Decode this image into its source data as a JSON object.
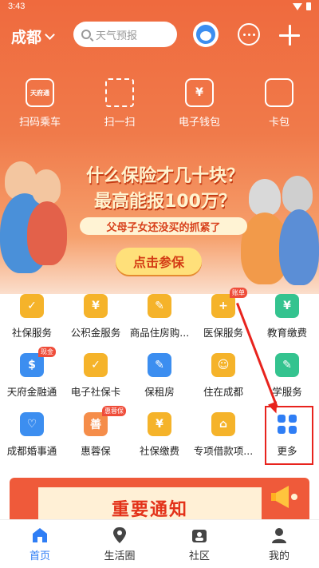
{
  "status_bar": {
    "time": "3:43"
  },
  "header": {
    "city": "成都",
    "search_placeholder": "天气预报"
  },
  "quick_actions": [
    {
      "label": "扫码乘车",
      "icon": "bus-card-icon",
      "glyph": "天府通"
    },
    {
      "label": "扫一扫",
      "icon": "scan-icon",
      "glyph": ""
    },
    {
      "label": "电子钱包",
      "icon": "wallet-icon",
      "glyph": "¥"
    },
    {
      "label": "卡包",
      "icon": "card-wallet-icon",
      "glyph": ""
    }
  ],
  "banner": {
    "title_line1": "什么保险才几十块？",
    "title_line2": "最高能报100万？",
    "subtitle": "父母子女还没买的抓紧了",
    "cta": "点击参保"
  },
  "services": [
    {
      "label": "社保服务",
      "icon": "shield-check-icon",
      "color": "#f5b32a",
      "glyph": "✓",
      "badge": ""
    },
    {
      "label": "公积金服务",
      "icon": "house-yuan-icon",
      "color": "#f5b32a",
      "glyph": "¥",
      "badge": ""
    },
    {
      "label": "商品住房购...",
      "icon": "house-pen-icon",
      "color": "#f5b32a",
      "glyph": "✎",
      "badge": ""
    },
    {
      "label": "医保服务",
      "icon": "medical-card-icon",
      "color": "#f5b32a",
      "glyph": "+",
      "badge": "账单"
    },
    {
      "label": "教育缴费",
      "icon": "wallet-yuan-icon",
      "color": "#34c38f",
      "glyph": "¥",
      "badge": ""
    },
    {
      "label": "天府金融通",
      "icon": "money-bag-icon",
      "color": "#3c8ef0",
      "glyph": "$",
      "badge": "现金"
    },
    {
      "label": "电子社保卡",
      "icon": "shield-card-icon",
      "color": "#f5b32a",
      "glyph": "✓",
      "badge": ""
    },
    {
      "label": "保租房",
      "icon": "rent-house-icon",
      "color": "#3c8ef0",
      "glyph": "✎",
      "badge": ""
    },
    {
      "label": "住在成都",
      "icon": "home-face-icon",
      "color": "#f5b32a",
      "glyph": "☺",
      "badge": ""
    },
    {
      "label": "学服务",
      "icon": "study-icon",
      "color": "#34c38f",
      "glyph": "✎",
      "badge": ""
    },
    {
      "label": "成都婚事通",
      "icon": "wedding-icon",
      "color": "#3c8ef0",
      "glyph": "♡",
      "badge": ""
    },
    {
      "label": "惠蓉保",
      "icon": "insurance-icon",
      "color": "#f58d4a",
      "glyph": "善",
      "badge": "惠蓉保"
    },
    {
      "label": "社保缴费",
      "icon": "payment-icon",
      "color": "#f5b32a",
      "glyph": "¥",
      "badge": ""
    },
    {
      "label": "专项借款项...",
      "icon": "loan-house-icon",
      "color": "#f5b32a",
      "glyph": "⌂",
      "badge": ""
    },
    {
      "label": "更多",
      "icon": "grid-more-icon",
      "color": "#2f7ef5",
      "glyph": "",
      "badge": ""
    }
  ],
  "notice": {
    "title": "重要通知"
  },
  "bottom_nav": [
    {
      "label": "首页",
      "icon": "home-icon",
      "active": true
    },
    {
      "label": "生活圈",
      "icon": "location-pin-icon",
      "active": false
    },
    {
      "label": "社区",
      "icon": "community-icon",
      "active": false
    },
    {
      "label": "我的",
      "icon": "profile-icon",
      "active": false
    }
  ]
}
